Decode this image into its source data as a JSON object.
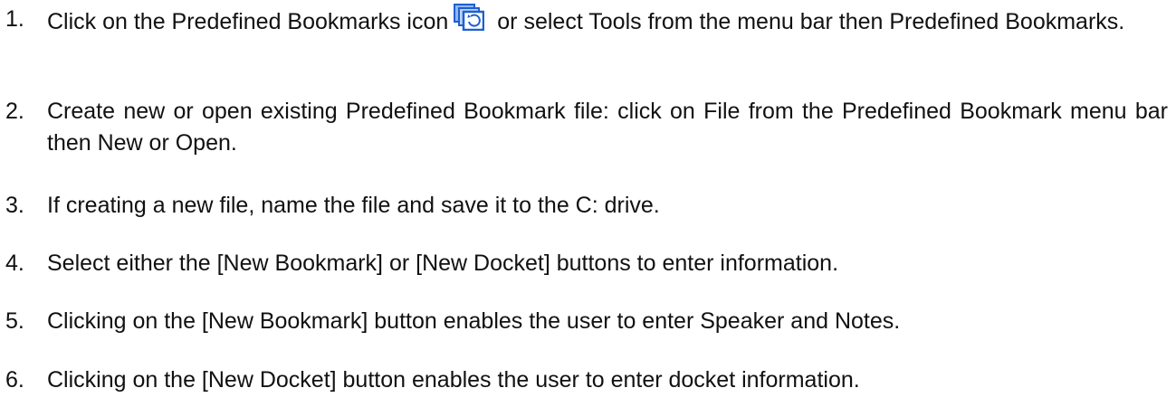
{
  "steps": [
    {
      "num": "1.",
      "text_before_icon": "Click on the Predefined Bookmarks icon",
      "icon": "predefined-bookmarks-icon",
      "text_after_icon": "or select Tools from the menu bar then Predefined Bookmarks."
    },
    {
      "num": "2.",
      "text": "Create new or open existing Predefined Bookmark file: click on File from the Predefined Bookmark menu bar then New or Open."
    },
    {
      "num": "3.",
      "text": "If creating a new file, name the file and save it to the C: drive."
    },
    {
      "num": "4.",
      "text": "Select either the [New Bookmark] or [New Docket] buttons to enter information."
    },
    {
      "num": "5.",
      "text": "Clicking on the [New Bookmark] button enables the user to enter Speaker and Notes."
    },
    {
      "num": "6.",
      "text": "Clicking on the [New Docket] button enables the user to enter docket information."
    }
  ],
  "colors": {
    "text": "#111111",
    "icon_blue": "#1f5fd0",
    "icon_light": "#8fb8f0"
  }
}
